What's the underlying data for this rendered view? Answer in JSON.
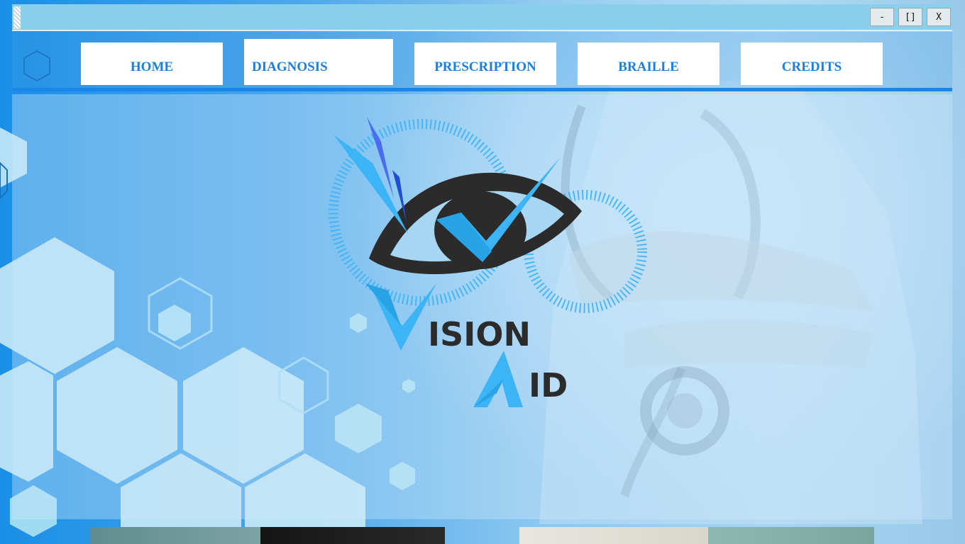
{
  "window": {
    "minimize_label": "-",
    "maximize_label": "[]",
    "close_label": "X"
  },
  "nav": {
    "items": [
      {
        "label": "HOME"
      },
      {
        "label": "DIAGNOSIS"
      },
      {
        "label": "PRESCRIPTION"
      },
      {
        "label": "BRAILLE"
      },
      {
        "label": "CREDITS"
      }
    ]
  },
  "logo": {
    "word1": "ISION",
    "word2": "ID"
  },
  "colors": {
    "accent": "#1a7fe0",
    "nav_divider": "#1a85ea",
    "logo_blue": "#3db4f5",
    "logo_dark": "#2b2b2b"
  }
}
